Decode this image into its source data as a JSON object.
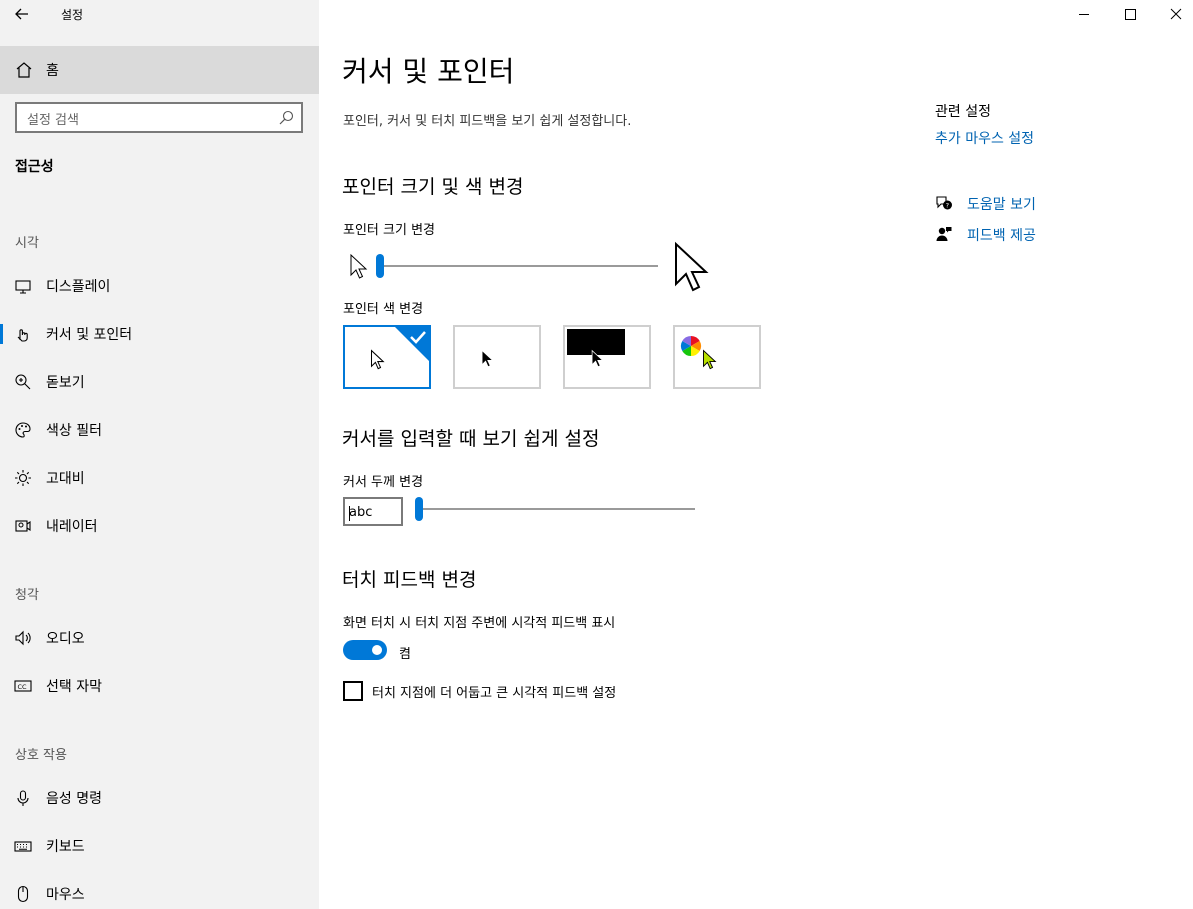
{
  "titlebar": {
    "title": "설정"
  },
  "sidebar": {
    "home_label": "홈",
    "search_placeholder": "설정 검색",
    "section_title": "접근성",
    "groups": [
      {
        "label": "시각"
      },
      {
        "label": "청각"
      },
      {
        "label": "상호 작용"
      }
    ],
    "items": [
      {
        "label": "디스플레이",
        "icon": "monitor-icon"
      },
      {
        "label": "커서 및 포인터",
        "icon": "pointer-hand-icon",
        "active": true
      },
      {
        "label": "돋보기",
        "icon": "magnifier-icon"
      },
      {
        "label": "색상 필터",
        "icon": "palette-icon"
      },
      {
        "label": "고대비",
        "icon": "sun-icon"
      },
      {
        "label": "내레이터",
        "icon": "narrator-icon"
      },
      {
        "label": "오디오",
        "icon": "speaker-icon"
      },
      {
        "label": "선택 자막",
        "icon": "cc-icon"
      },
      {
        "label": "음성 명령",
        "icon": "microphone-icon"
      },
      {
        "label": "키보드",
        "icon": "keyboard-icon"
      },
      {
        "label": "마우스",
        "icon": "mouse-icon"
      }
    ]
  },
  "main": {
    "title": "커서 및 포인터",
    "description": "포인터, 커서 및 터치 피드백을 보기 쉽게 설정합니다.",
    "pointer_section": {
      "heading": "포인터 크기 및 색 변경",
      "size_label": "포인터 크기 변경",
      "size_value": 1,
      "color_label": "포인터 색 변경",
      "color_options": [
        "white",
        "black",
        "inverted",
        "custom"
      ],
      "selected_color": "white"
    },
    "cursor_section": {
      "heading": "커서를 입력할 때 보기 쉽게 설정",
      "thickness_label": "커서 두께 변경",
      "preview_text": "abc",
      "thickness_value": 1
    },
    "touch_section": {
      "heading": "터치 피드백 변경",
      "toggle_label": "화면 터치 시 터치 지점 주변에 시각적 피드백 표시",
      "toggle_state": "켬",
      "toggle_on": true,
      "checkbox_label": "터치 지점에 더 어둡고 큰 시각적 피드백 설정",
      "checkbox_checked": false
    }
  },
  "related": {
    "heading": "관련 설정",
    "link": "추가 마우스 설정",
    "help": "도움말 보기",
    "feedback": "피드백 제공"
  },
  "colors": {
    "accent": "#0078d7",
    "link": "#0063b1",
    "sidebar_bg": "#f2f2f2",
    "home_bg": "#dadada",
    "custom_pointer": "#b8e000"
  }
}
